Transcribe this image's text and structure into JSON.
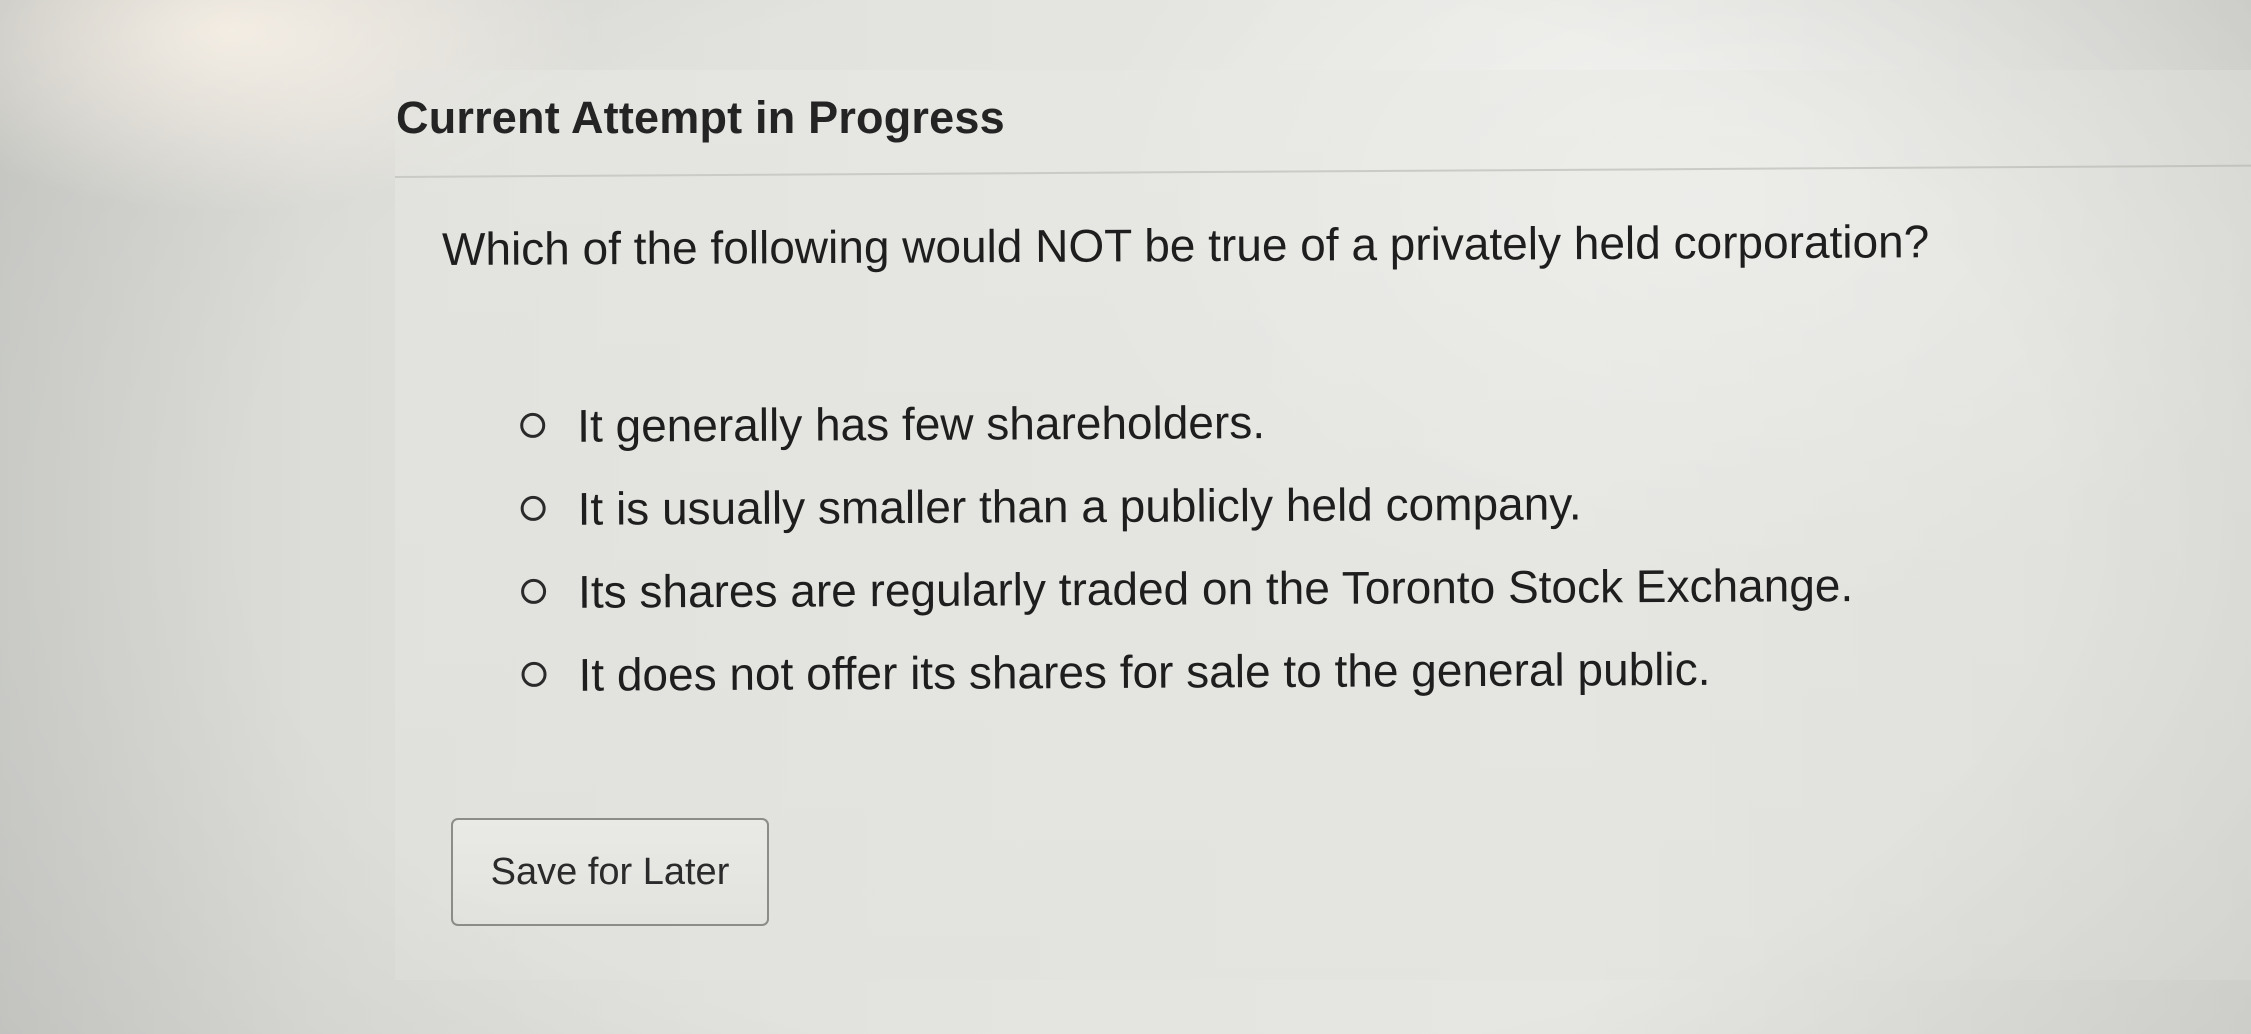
{
  "header": {
    "title": "Current Attempt in Progress"
  },
  "question": {
    "text": "Which of the following would NOT be true of a privately held corporation?",
    "options": [
      {
        "label": "It generally has few shareholders.",
        "selected": false
      },
      {
        "label": "It is usually smaller than a publicly held company.",
        "selected": false
      },
      {
        "label": "Its shares are regularly traded on the Toronto Stock Exchange.",
        "selected": false
      },
      {
        "label": "It does not offer its shares for sale to the general public.",
        "selected": false
      }
    ]
  },
  "actions": {
    "save_label": "Save for Later"
  },
  "colors": {
    "text": "#1e1e1e",
    "button_border": "#8c8c88",
    "background": "#e3e3df"
  }
}
